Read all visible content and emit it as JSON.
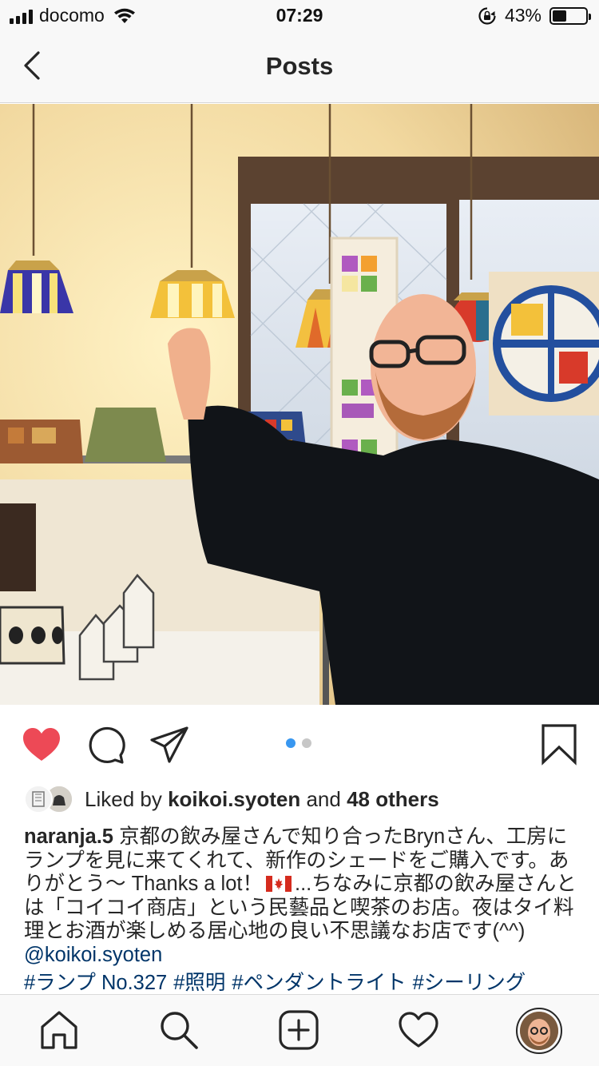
{
  "status_bar": {
    "carrier": "docomo",
    "time": "07:29",
    "battery_percent": "43%",
    "battery_level": 0.43,
    "icons": [
      "signal-icon",
      "wifi-icon",
      "rotation-lock-icon",
      "battery-icon"
    ]
  },
  "nav": {
    "title": "Posts",
    "back_icon": "chevron-left-icon"
  },
  "post": {
    "photo_alt": "photo",
    "carousel": {
      "count": 2,
      "active": 1
    },
    "actions": [
      "heart-icon",
      "comment-icon",
      "share-icon",
      "bookmark-icon"
    ],
    "liked": true,
    "likes": {
      "prefix": "Liked by",
      "user": "koikoi.syoten",
      "middle": "and",
      "others": "48 others"
    },
    "caption": {
      "user": "naranja.5",
      "text_before_flag": "京都の飲み屋さんで知り合ったBrynさん、工房にランプを見に来てくれて、新作のシェードをご購入です。ありがとう〜 Thanks a lot！",
      "text_after_flag": "...ちなみに京都の飲み屋さんとは「コイコイ商店」という民藝品と喫茶のお店。夜はタイ料理とお酒が楽しめる居心地の良い不思議なお店です(^^)",
      "mention": "@koikoi.syoten"
    },
    "hashtags": [
      "#ランプ No.327",
      "#照明",
      "#ペンダントライト",
      "#シーリング"
    ]
  },
  "tab_bar": {
    "icons": [
      "home-icon",
      "search-icon",
      "add-icon",
      "heart-icon",
      "profile-avatar"
    ]
  },
  "colors": {
    "like_red": "#ed4956",
    "link_blue": "#003569",
    "dot_active": "#3897f0",
    "bar_bg": "#f8f8f8"
  }
}
